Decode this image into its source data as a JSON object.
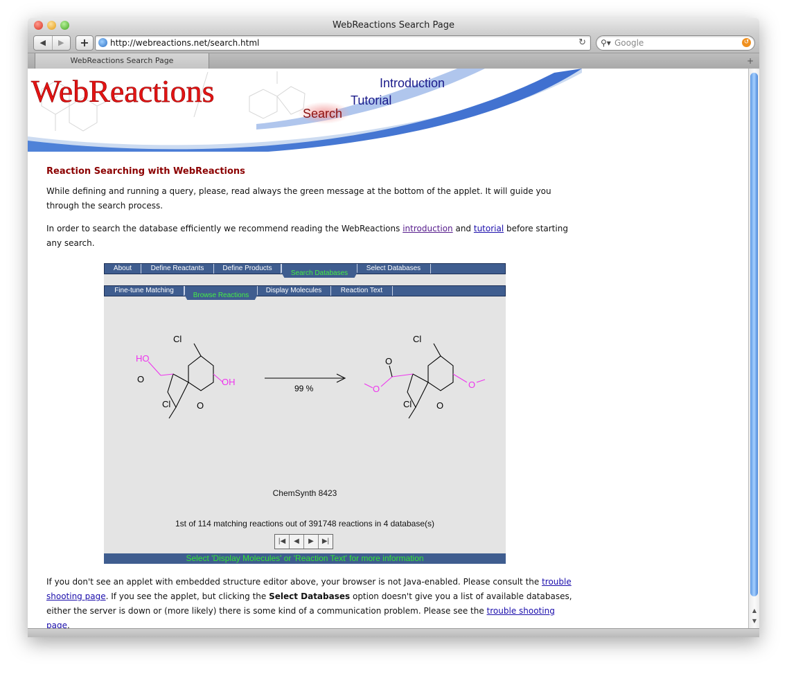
{
  "window": {
    "title": "WebReactions Search Page",
    "url": "http://webreactions.net/search.html",
    "search_placeholder": "Google",
    "tab_title": "WebReactions Search Page",
    "nav_back": "◀",
    "nav_forward": "▶",
    "add": "+",
    "reload": "↻",
    "tab_add": "+"
  },
  "banner": {
    "logo": "WebReactions",
    "nav_introduction": "Introduction",
    "nav_tutorial": "Tutorial",
    "nav_search": "Search"
  },
  "content": {
    "heading": "Reaction Searching with WebReactions",
    "para1": "While defining and running a query, please, read always the green message at the bottom of the applet. It will guide you through the search process.",
    "para2_before": "In order to search the database efficiently we recommend reading the WebReactions ",
    "para2_link1": "introduction",
    "para2_mid": " and ",
    "para2_link2": "tutorial",
    "para2_after": " before starting any search.",
    "para3_a": "If you don't see an applet with embedded structure editor above, your browser is not Java-enabled. Please consult the ",
    "para3_link1": "trouble shooting page",
    "para3_b": ". If you see the applet, but clicking the ",
    "para3_bold": "Select Databases",
    "para3_c": " option doesn't give you a list of available databases, either the server is down or (more likely) there is some kind of a communication problem. Please see the ",
    "para3_link2": "trouble shooting page",
    "para3_d": "."
  },
  "applet": {
    "tabs1": [
      "About",
      "Define Reactants",
      "Define Products",
      "Search Databases",
      "Select Databases"
    ],
    "tabs2": [
      "Fine-tune Matching",
      "Browse Reactions",
      "Display Molecules",
      "Reaction Text"
    ],
    "yield": "99 %",
    "reactant_labels": {
      "cl1": "Cl",
      "ho": "HO",
      "o1": "O",
      "oh": "OH",
      "cl2": "Cl",
      "o2": "O"
    },
    "product_labels": {
      "cl1": "Cl",
      "o_carb": "O",
      "o_ester": "O",
      "o_ether": "O",
      "cl2": "Cl",
      "o_ketone": "O"
    },
    "database_id": "ChemSynth 8423",
    "match_text": "1st of 114 matching reactions out of 391748 reactions in 4 database(s)",
    "nav_buttons": [
      "|◀",
      "◀",
      "▶",
      "▶|"
    ],
    "status_message": "Select 'Display Molecules' or 'Reaction Text' for more information"
  },
  "colors": {
    "heading": "#8b0000",
    "applet_bar": "#3f5d8f",
    "highlight": "#ee33ee",
    "status_green": "#33e633"
  }
}
